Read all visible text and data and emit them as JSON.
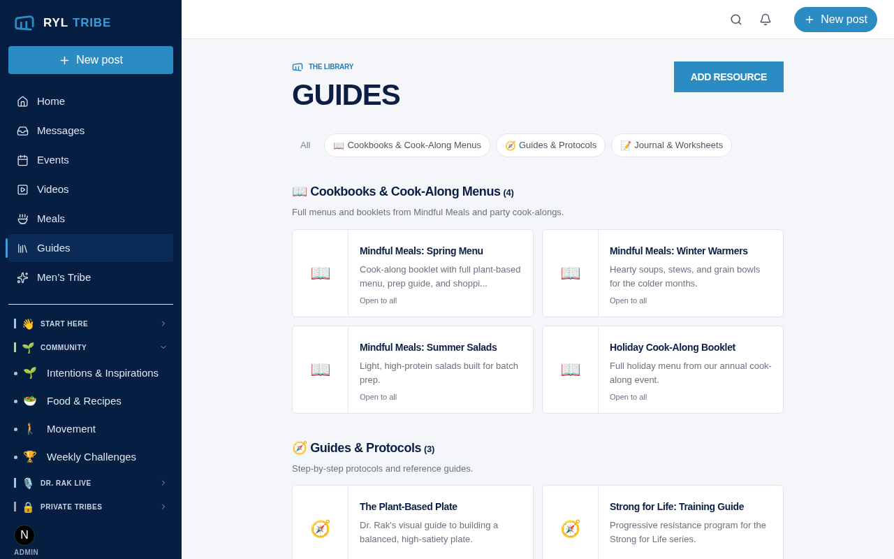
{
  "brand": {
    "name_first": "RYL",
    "name_second": "TRIBE"
  },
  "sidebar": {
    "new_post": "New post",
    "nav": [
      {
        "kind": "home",
        "label": "Home",
        "selected": false
      },
      {
        "kind": "messages",
        "label": "Messages",
        "selected": false
      },
      {
        "kind": "events",
        "label": "Events",
        "selected": false
      },
      {
        "kind": "videos",
        "label": "Videos",
        "selected": false
      },
      {
        "kind": "meals",
        "label": "Meals",
        "selected": false
      },
      {
        "kind": "guides",
        "label": "Guides",
        "selected": true
      },
      {
        "kind": "tribe",
        "label": "Men’s Tribe",
        "selected": false
      }
    ],
    "sections": [
      {
        "emoji": "👋",
        "label": "START HERE",
        "expanded": false,
        "color": "#9cc9ec"
      },
      {
        "emoji": "🌱",
        "label": "COMMUNITY",
        "expanded": true,
        "color": "#a8d5b5",
        "children": [
          {
            "emoji": "🌱",
            "label": "Intentions & Inspirations"
          },
          {
            "emoji": "🥗",
            "label": "Food & Recipes"
          },
          {
            "emoji": "🚶",
            "label": "Movement"
          },
          {
            "emoji": "🏆",
            "label": "Weekly Challenges"
          }
        ]
      },
      {
        "emoji": "🎙️",
        "label": "DR. RAK LIVE",
        "expanded": false,
        "color": "#9cc9ec"
      },
      {
        "emoji": "🔒",
        "label": "PRIVATE TRIBES",
        "expanded": false,
        "color": "#9ca3af"
      }
    ],
    "avatar": {
      "initial": "N",
      "role": "ADMIN"
    }
  },
  "topbar": {
    "new_post": "New post"
  },
  "page": {
    "eyebrow": "THE LIBRARY",
    "title": "GUIDES",
    "add_button": "ADD RESOURCE",
    "filters": [
      {
        "label": "All",
        "selected": true
      },
      {
        "emoji": "📖",
        "label": "Cookbooks & Cook-Along Menus",
        "selected": false
      },
      {
        "emoji": "🧭",
        "label": "Guides & Protocols",
        "selected": false
      },
      {
        "emoji": "📝",
        "label": "Journal & Worksheets",
        "selected": false
      }
    ],
    "sections": [
      {
        "emoji": "📖",
        "title": "Cookbooks & Cook-Along Menus",
        "count": "(4)",
        "description": "Full menus and booklets from Mindful Meals and party cook-alongs.",
        "items": [
          {
            "emoji": "📖",
            "title": "Mindful Meals: Spring Menu",
            "description": "Cook-along booklet with full plant-based menu, prep guide, and shoppi...",
            "access": "Open to all"
          },
          {
            "emoji": "📖",
            "title": "Mindful Meals: Winter Warmers",
            "description": "Hearty soups, stews, and grain bowls for the colder months.",
            "access": "Open to all"
          },
          {
            "emoji": "📖",
            "title": "Mindful Meals: Summer Salads",
            "description": "Light, high-protein salads built for batch prep.",
            "access": "Open to all"
          },
          {
            "emoji": "📖",
            "title": "Holiday Cook-Along Booklet",
            "description": "Full holiday menu from our annual cook-along event.",
            "access": "Open to all"
          }
        ]
      },
      {
        "emoji": "🧭",
        "title": "Guides & Protocols",
        "count": "(3)",
        "description": "Step-by-step protocols and reference guides.",
        "items": [
          {
            "emoji": "🧭",
            "title": "The Plant-Based Plate",
            "description": "Dr. Rak's visual guide to building a balanced, high-satiety plate."
          },
          {
            "emoji": "🧭",
            "title": "Strong for Life: Training Guide",
            "description": "Progressive resistance program for the Strong for Life series."
          }
        ]
      }
    ]
  }
}
